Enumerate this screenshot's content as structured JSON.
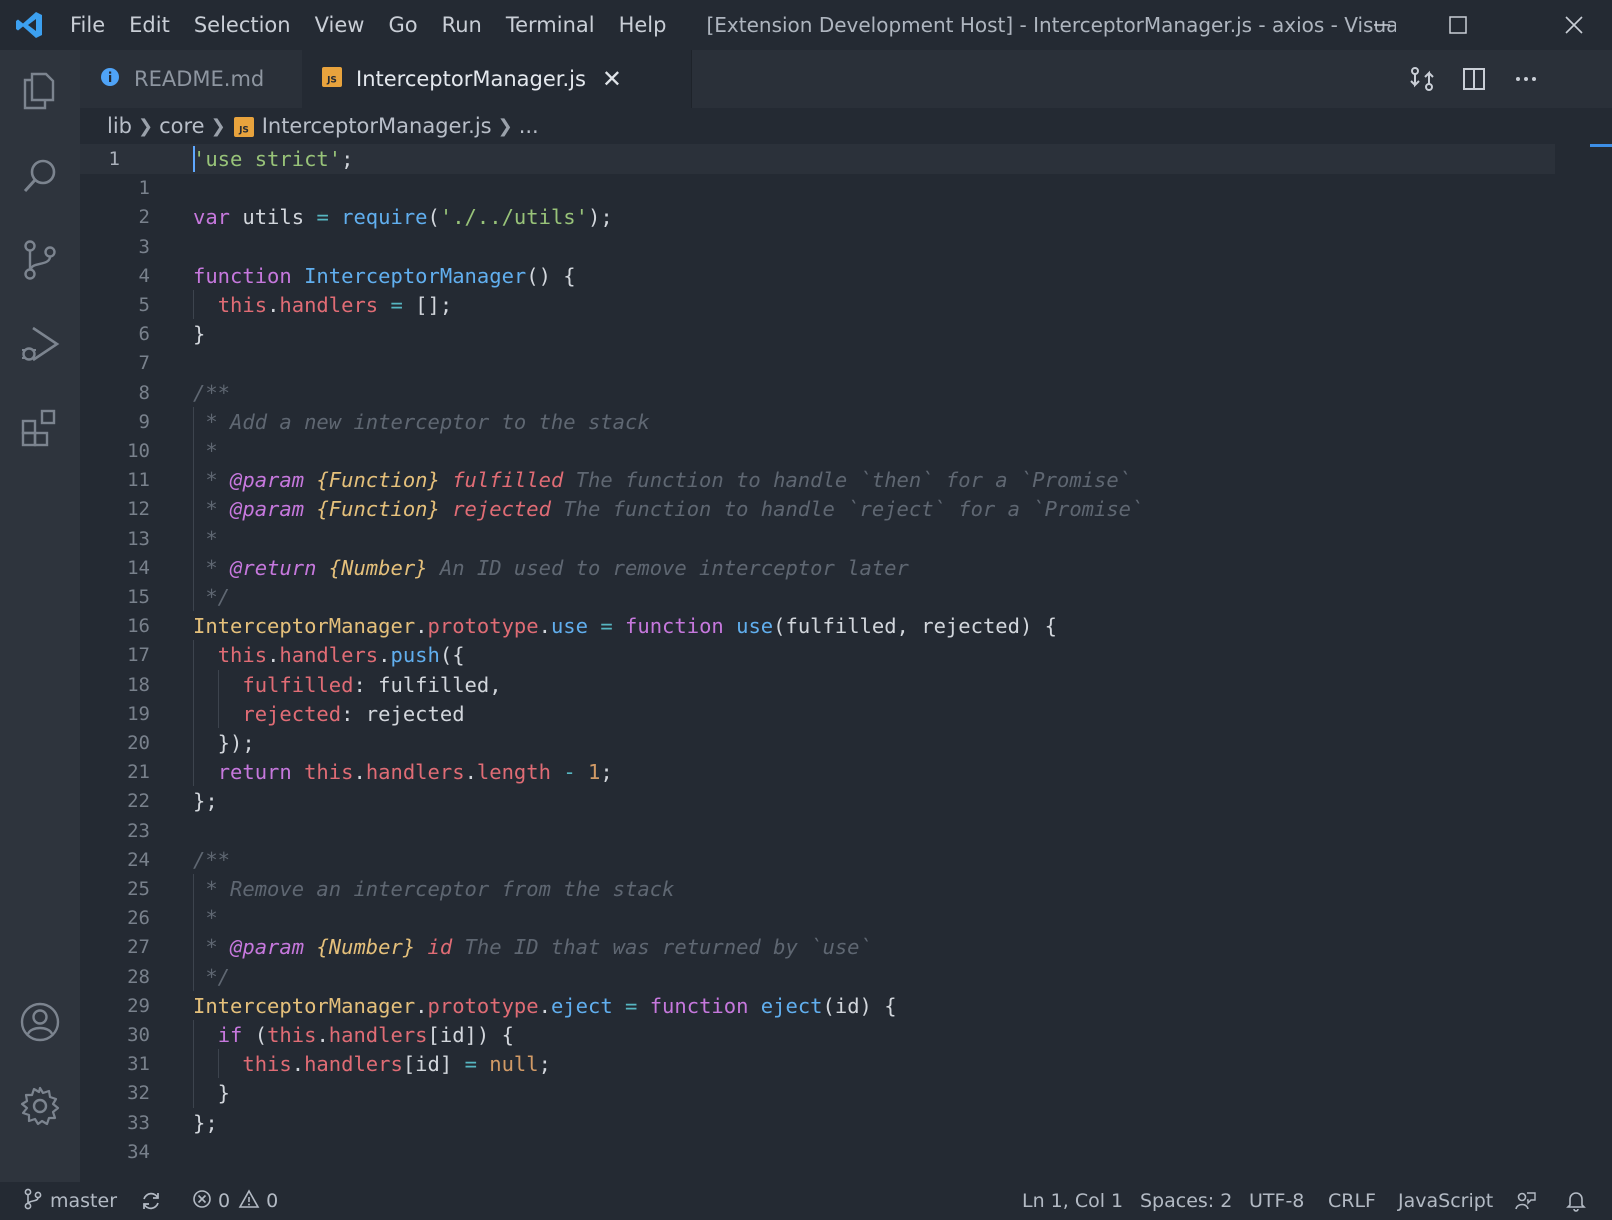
{
  "titlebar": {
    "menu": [
      "File",
      "Edit",
      "Selection",
      "View",
      "Go",
      "Run",
      "Terminal",
      "Help"
    ],
    "window_title": "[Extension Development Host] - InterceptorManager.js - axios - Visual Studi..."
  },
  "tabs": [
    {
      "label": "README.md",
      "icon": "info-icon",
      "active": false
    },
    {
      "label": "InterceptorManager.js",
      "icon": "js-file-icon",
      "active": true
    }
  ],
  "breadcrumb": {
    "parts": [
      "lib",
      "core",
      "InterceptorManager.js",
      "..."
    ]
  },
  "editor": {
    "line_numbers": [
      "1",
      "1",
      "2",
      "3",
      "4",
      "5",
      "6",
      "7",
      "8",
      "9",
      "10",
      "11",
      "12",
      "13",
      "14",
      "15",
      "16",
      "17",
      "18",
      "19",
      "20",
      "21",
      "22",
      "23",
      "24",
      "25",
      "26",
      "27",
      "28",
      "29",
      "30",
      "31",
      "32",
      "33",
      "34"
    ],
    "lines": [
      [
        {
          "t": "'use strict'",
          "c": "s"
        },
        {
          "t": ";",
          "c": "pl"
        }
      ],
      [],
      [
        {
          "t": "var",
          "c": "k"
        },
        {
          "t": " utils ",
          "c": "pl"
        },
        {
          "t": "=",
          "c": "op"
        },
        {
          "t": " ",
          "c": "pl"
        },
        {
          "t": "require",
          "c": "fn"
        },
        {
          "t": "(",
          "c": "pl"
        },
        {
          "t": "'./../utils'",
          "c": "s"
        },
        {
          "t": ");",
          "c": "pl"
        }
      ],
      [],
      [
        {
          "t": "function",
          "c": "k"
        },
        {
          "t": " ",
          "c": "pl"
        },
        {
          "t": "InterceptorManager",
          "c": "fn"
        },
        {
          "t": "() {",
          "c": "pl"
        }
      ],
      [
        {
          "t": "  ",
          "c": "pl"
        },
        {
          "t": "this",
          "c": "prop"
        },
        {
          "t": ".",
          "c": "pl"
        },
        {
          "t": "handlers",
          "c": "prop"
        },
        {
          "t": " ",
          "c": "pl"
        },
        {
          "t": "=",
          "c": "op"
        },
        {
          "t": " [];",
          "c": "pl"
        }
      ],
      [
        {
          "t": "}",
          "c": "pl"
        }
      ],
      [],
      [
        {
          "t": "/**",
          "c": "cm"
        }
      ],
      [
        {
          "t": " * Add a new interceptor to the stack",
          "c": "cm"
        }
      ],
      [
        {
          "t": " *",
          "c": "cm"
        }
      ],
      [
        {
          "t": " * ",
          "c": "cm"
        },
        {
          "t": "@param",
          "c": "tag"
        },
        {
          "t": " ",
          "c": "cm"
        },
        {
          "t": "{Function}",
          "c": "ty"
        },
        {
          "t": " ",
          "c": "cm"
        },
        {
          "t": "fulfilled",
          "c": "pn"
        },
        {
          "t": " The function to handle `then` for a `Promise`",
          "c": "cm"
        }
      ],
      [
        {
          "t": " * ",
          "c": "cm"
        },
        {
          "t": "@param",
          "c": "tag"
        },
        {
          "t": " ",
          "c": "cm"
        },
        {
          "t": "{Function}",
          "c": "ty"
        },
        {
          "t": " ",
          "c": "cm"
        },
        {
          "t": "rejected",
          "c": "pn"
        },
        {
          "t": " The function to handle `reject` for a `Promise`",
          "c": "cm"
        }
      ],
      [
        {
          "t": " *",
          "c": "cm"
        }
      ],
      [
        {
          "t": " * ",
          "c": "cm"
        },
        {
          "t": "@return",
          "c": "tag"
        },
        {
          "t": " ",
          "c": "cm"
        },
        {
          "t": "{Number}",
          "c": "ty"
        },
        {
          "t": " An ID used to remove interceptor later",
          "c": "cm"
        }
      ],
      [
        {
          "t": " */",
          "c": "cm"
        }
      ],
      [
        {
          "t": "InterceptorManager",
          "c": "cls"
        },
        {
          "t": ".",
          "c": "pl"
        },
        {
          "t": "prototype",
          "c": "prop"
        },
        {
          "t": ".",
          "c": "pl"
        },
        {
          "t": "use",
          "c": "fn"
        },
        {
          "t": " ",
          "c": "pl"
        },
        {
          "t": "=",
          "c": "op"
        },
        {
          "t": " ",
          "c": "pl"
        },
        {
          "t": "function",
          "c": "k"
        },
        {
          "t": " ",
          "c": "pl"
        },
        {
          "t": "use",
          "c": "fn"
        },
        {
          "t": "(fulfilled, rejected) {",
          "c": "pl"
        }
      ],
      [
        {
          "t": "  ",
          "c": "pl"
        },
        {
          "t": "this",
          "c": "prop"
        },
        {
          "t": ".",
          "c": "pl"
        },
        {
          "t": "handlers",
          "c": "prop"
        },
        {
          "t": ".",
          "c": "pl"
        },
        {
          "t": "push",
          "c": "fn"
        },
        {
          "t": "({",
          "c": "pl"
        }
      ],
      [
        {
          "t": "    ",
          "c": "pl"
        },
        {
          "t": "fulfilled",
          "c": "prop"
        },
        {
          "t": ":",
          "c": "pl"
        },
        {
          "t": " fulfilled,",
          "c": "pl"
        }
      ],
      [
        {
          "t": "    ",
          "c": "pl"
        },
        {
          "t": "rejected",
          "c": "prop"
        },
        {
          "t": ":",
          "c": "pl"
        },
        {
          "t": " rejected",
          "c": "pl"
        }
      ],
      [
        {
          "t": "  });",
          "c": "pl"
        }
      ],
      [
        {
          "t": "  ",
          "c": "pl"
        },
        {
          "t": "return",
          "c": "k"
        },
        {
          "t": " ",
          "c": "pl"
        },
        {
          "t": "this",
          "c": "prop"
        },
        {
          "t": ".",
          "c": "pl"
        },
        {
          "t": "handlers",
          "c": "prop"
        },
        {
          "t": ".",
          "c": "pl"
        },
        {
          "t": "length",
          "c": "prop"
        },
        {
          "t": " ",
          "c": "pl"
        },
        {
          "t": "-",
          "c": "op"
        },
        {
          "t": " ",
          "c": "pl"
        },
        {
          "t": "1",
          "c": "num"
        },
        {
          "t": ";",
          "c": "pl"
        }
      ],
      [
        {
          "t": "};",
          "c": "pl"
        }
      ],
      [],
      [
        {
          "t": "/**",
          "c": "cm"
        }
      ],
      [
        {
          "t": " * Remove an interceptor from the stack",
          "c": "cm"
        }
      ],
      [
        {
          "t": " *",
          "c": "cm"
        }
      ],
      [
        {
          "t": " * ",
          "c": "cm"
        },
        {
          "t": "@param",
          "c": "tag"
        },
        {
          "t": " ",
          "c": "cm"
        },
        {
          "t": "{Number}",
          "c": "ty"
        },
        {
          "t": " ",
          "c": "cm"
        },
        {
          "t": "id",
          "c": "pn"
        },
        {
          "t": " The ID that was returned by `use`",
          "c": "cm"
        }
      ],
      [
        {
          "t": " */",
          "c": "cm"
        }
      ],
      [
        {
          "t": "InterceptorManager",
          "c": "cls"
        },
        {
          "t": ".",
          "c": "pl"
        },
        {
          "t": "prototype",
          "c": "prop"
        },
        {
          "t": ".",
          "c": "pl"
        },
        {
          "t": "eject",
          "c": "fn"
        },
        {
          "t": " ",
          "c": "pl"
        },
        {
          "t": "=",
          "c": "op"
        },
        {
          "t": " ",
          "c": "pl"
        },
        {
          "t": "function",
          "c": "k"
        },
        {
          "t": " ",
          "c": "pl"
        },
        {
          "t": "eject",
          "c": "fn"
        },
        {
          "t": "(id) {",
          "c": "pl"
        }
      ],
      [
        {
          "t": "  ",
          "c": "pl"
        },
        {
          "t": "if",
          "c": "k"
        },
        {
          "t": " (",
          "c": "pl"
        },
        {
          "t": "this",
          "c": "prop"
        },
        {
          "t": ".",
          "c": "pl"
        },
        {
          "t": "handlers",
          "c": "prop"
        },
        {
          "t": "[id]) {",
          "c": "pl"
        }
      ],
      [
        {
          "t": "    ",
          "c": "pl"
        },
        {
          "t": "this",
          "c": "prop"
        },
        {
          "t": ".",
          "c": "pl"
        },
        {
          "t": "handlers",
          "c": "prop"
        },
        {
          "t": "[id] ",
          "c": "pl"
        },
        {
          "t": "=",
          "c": "op"
        },
        {
          "t": " ",
          "c": "pl"
        },
        {
          "t": "null",
          "c": "num"
        },
        {
          "t": ";",
          "c": "pl"
        }
      ],
      [
        {
          "t": "  }",
          "c": "pl"
        }
      ],
      [
        {
          "t": "};",
          "c": "pl"
        }
      ],
      []
    ]
  },
  "statusbar": {
    "branch": "master",
    "errors": "0",
    "warnings": "0",
    "position": "Ln 1, Col 1",
    "indent": "Spaces: 2",
    "encoding": "UTF-8",
    "eol": "CRLF",
    "language": "JavaScript"
  },
  "colors": {
    "accent": "#3d8ee6",
    "background": "#242a33",
    "activitybar": "#2e343d",
    "vscode_logo": "#3ca0f0",
    "js_badge": "#e8a33d"
  }
}
